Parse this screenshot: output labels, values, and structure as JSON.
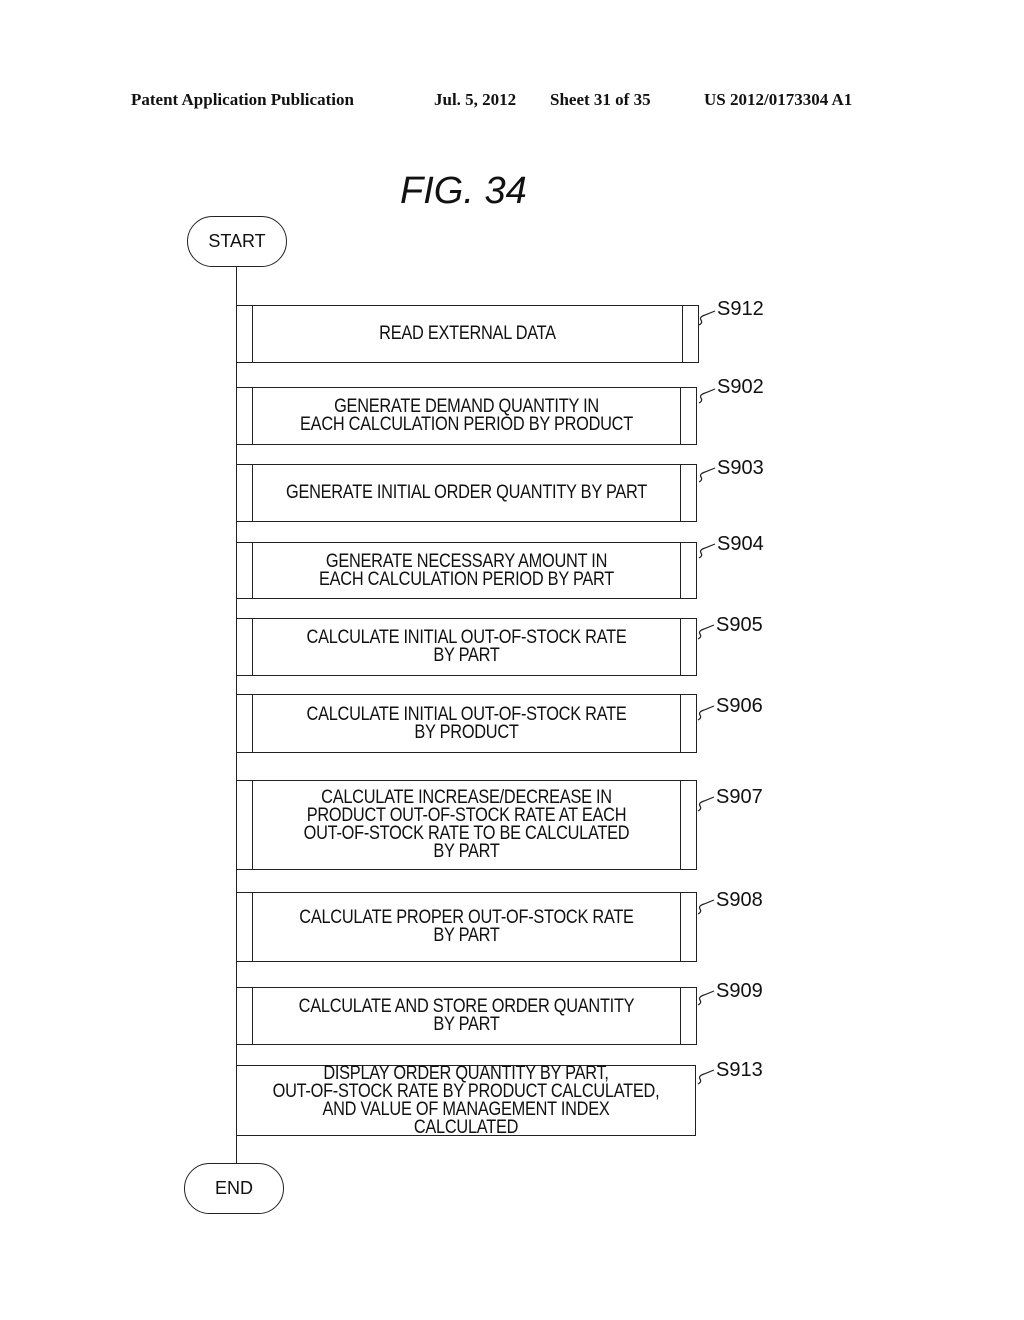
{
  "header": {
    "publication": "Patent Application Publication",
    "date": "Jul. 5, 2012",
    "sheet": "Sheet 31 of 35",
    "number": "US 2012/0173304 A1"
  },
  "figure": {
    "title": "FIG.  34",
    "start_label": "START",
    "end_label": "END",
    "steps": [
      {
        "id": "S912",
        "type": "subroutine",
        "text": "READ EXTERNAL DATA"
      },
      {
        "id": "S902",
        "type": "subroutine",
        "text": "GENERATE DEMAND QUANTITY IN\nEACH CALCULATION PERIOD BY PRODUCT"
      },
      {
        "id": "S903",
        "type": "subroutine",
        "text": "GENERATE INITIAL ORDER QUANTITY BY PART"
      },
      {
        "id": "S904",
        "type": "subroutine",
        "text": "GENERATE NECESSARY AMOUNT IN\nEACH CALCULATION PERIOD BY PART"
      },
      {
        "id": "S905",
        "type": "subroutine",
        "text": "CALCULATE INITIAL OUT-OF-STOCK RATE\nBY PART"
      },
      {
        "id": "S906",
        "type": "subroutine",
        "text": "CALCULATE INITIAL OUT-OF-STOCK RATE\nBY PRODUCT"
      },
      {
        "id": "S907",
        "type": "subroutine",
        "text": "CALCULATE INCREASE/DECREASE IN\nPRODUCT OUT-OF-STOCK RATE AT EACH\nOUT-OF-STOCK RATE TO BE CALCULATED\nBY PART"
      },
      {
        "id": "S908",
        "type": "subroutine",
        "text": "CALCULATE PROPER OUT-OF-STOCK RATE\nBY PART"
      },
      {
        "id": "S909",
        "type": "subroutine",
        "text": "CALCULATE AND STORE ORDER QUANTITY\nBY PART"
      },
      {
        "id": "S913",
        "type": "process",
        "text": "DISPLAY ORDER QUANTITY BY PART,\nOUT-OF-STOCK RATE BY PRODUCT CALCULATED,\nAND VALUE OF MANAGEMENT INDEX CALCULATED"
      }
    ]
  }
}
